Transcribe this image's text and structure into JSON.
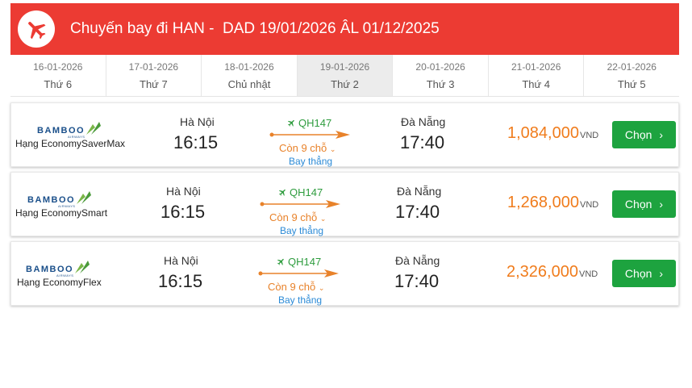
{
  "header": {
    "title": "Chuyến bay đi HAN -  DAD 19/01/2026 ÂL 01/12/2025",
    "color": "#ec3b33",
    "icon": "airplane-icon"
  },
  "dates": [
    {
      "date": "16-01-2026",
      "weekday": "Thứ 6"
    },
    {
      "date": "17-01-2026",
      "weekday": "Thứ 7"
    },
    {
      "date": "18-01-2026",
      "weekday": "Chủ nhật"
    },
    {
      "date": "19-01-2026",
      "weekday": "Thứ 2",
      "active": true
    },
    {
      "date": "20-01-2026",
      "weekday": "Thứ 3"
    },
    {
      "date": "21-01-2026",
      "weekday": "Thứ 4"
    },
    {
      "date": "22-01-2026",
      "weekday": "Thứ 5"
    }
  ],
  "flights": [
    {
      "airline_logo": "BAMBOO",
      "airline_sub": "AIRWAYS",
      "fare_class": "Hạng EconomySaverMax",
      "origin_city": "Hà Nội",
      "depart_time": "16:15",
      "flight_code": "QH147",
      "seats": "Còn 9 chỗ",
      "stops": "Bay thẳng",
      "dest_city": "Đà Nẵng",
      "arrive_time": "17:40",
      "price": "1,084,000",
      "currency": "VND",
      "button": "Chọn"
    },
    {
      "airline_logo": "BAMBOO",
      "airline_sub": "AIRWAYS",
      "fare_class": "Hạng EconomySmart",
      "origin_city": "Hà Nội",
      "depart_time": "16:15",
      "flight_code": "QH147",
      "seats": "Còn 9 chỗ",
      "stops": "Bay thẳng",
      "dest_city": "Đà Nẵng",
      "arrive_time": "17:40",
      "price": "1,268,000",
      "currency": "VND",
      "button": "Chọn"
    },
    {
      "airline_logo": "BAMBOO",
      "airline_sub": "AIRWAYS",
      "fare_class": "Hạng EconomyFlex",
      "origin_city": "Hà Nội",
      "depart_time": "16:15",
      "flight_code": "QH147",
      "seats": "Còn 9 chỗ",
      "stops": "Bay thẳng",
      "dest_city": "Đà Nẵng",
      "arrive_time": "17:40",
      "price": "2,326,000",
      "currency": "VND",
      "button": "Chọn"
    }
  ],
  "colors": {
    "price": "#f07c1c",
    "button": "#1da33f",
    "flight_code": "#2e9c3e",
    "seats": "#e8822a",
    "direct": "#2b8ad6",
    "brand": "#1a4f8a"
  }
}
